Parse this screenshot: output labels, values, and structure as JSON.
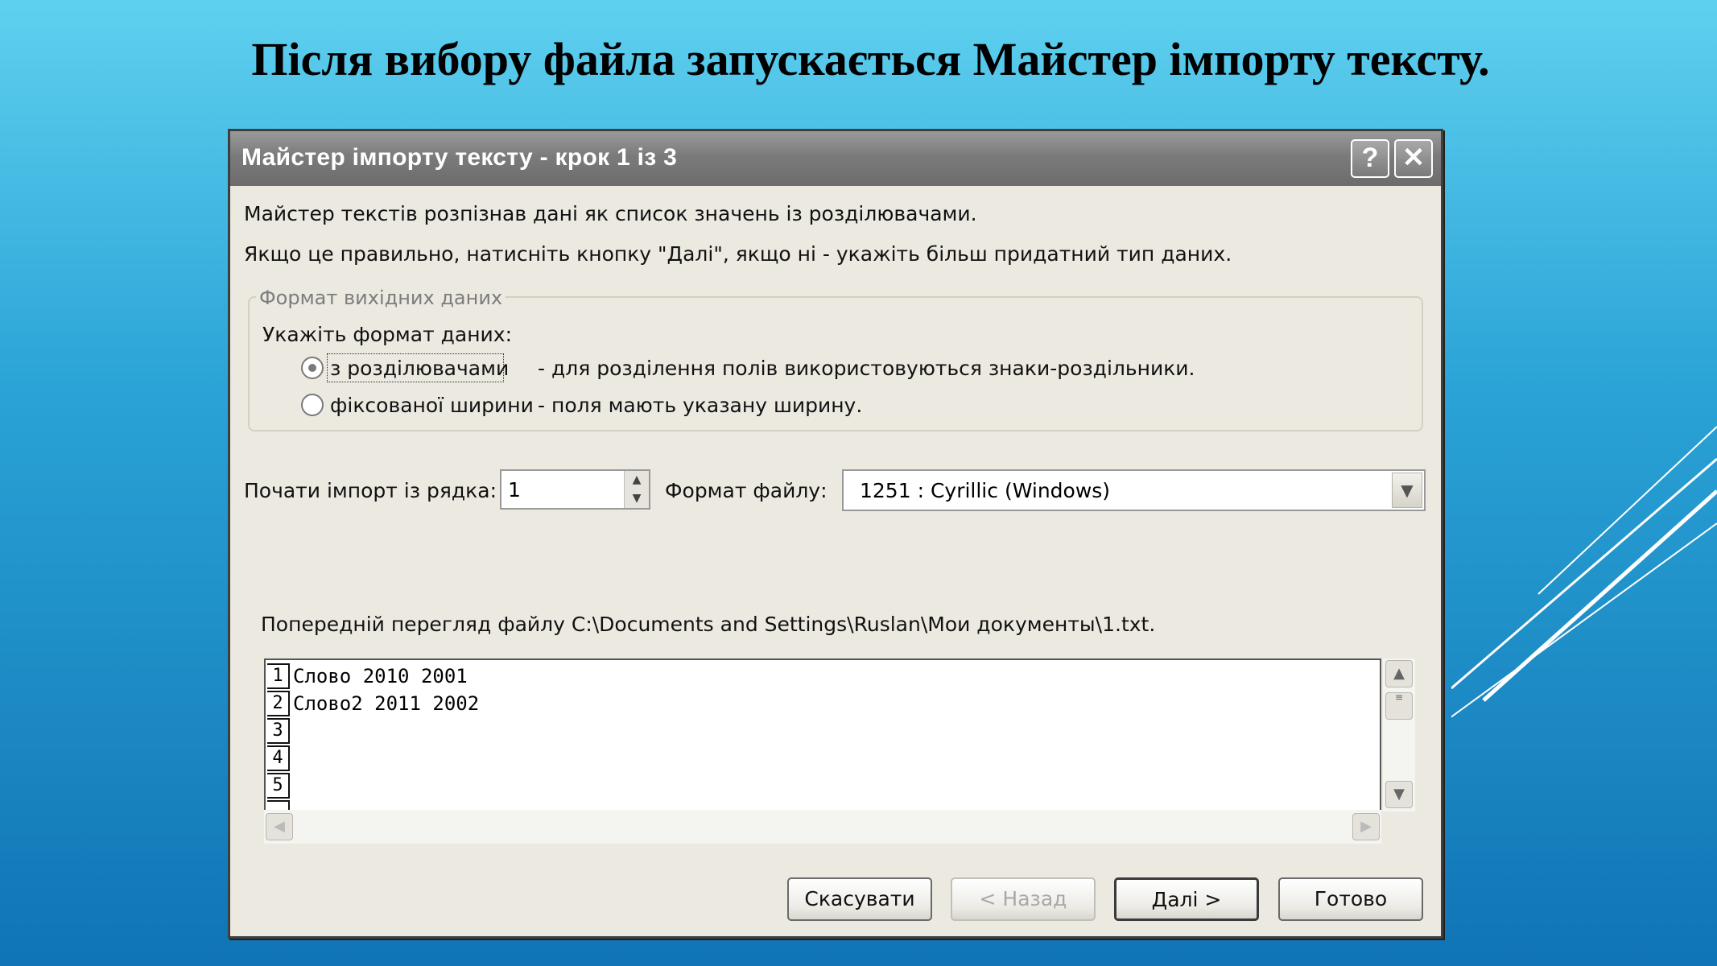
{
  "slide": {
    "title": "Після вибору файла запускається Майстер імпорту тексту."
  },
  "dialog": {
    "title": "Майстер імпорту тексту - крок 1 із 3",
    "help_label": "?",
    "close_label": "✕",
    "intro_line1": "Майстер текстів розпізнав дані як список значень із розділювачами.",
    "intro_line2": "Якщо це правильно, натисніть кнопку \"Далі\", якщо ні - укажіть більш придатний тип даних.",
    "group": {
      "legend": "Формат вихідних даних",
      "prompt": "Укажіть формат даних:",
      "options": [
        {
          "label": "з розділювачами",
          "description": "- для розділення полів використовуються знаки-роздільники.",
          "selected": true
        },
        {
          "label": "фіксованої ширини",
          "description": "- поля мають указану ширину.",
          "selected": false
        }
      ]
    },
    "start_row": {
      "label": "Почати імпорт із рядка:",
      "value": "1"
    },
    "file_format": {
      "label": "Формат файлу:",
      "value": "1251 : Cyrillic (Windows)"
    },
    "preview": {
      "label": "Попередній перегляд файлу C:\\Documents and Settings\\Ruslan\\Мои документы\\1.txt.",
      "rows": [
        {
          "num": "1",
          "text": "Слово 2010 2001"
        },
        {
          "num": "2",
          "text": "Слово2 2011 2002"
        },
        {
          "num": "3",
          "text": ""
        },
        {
          "num": "4",
          "text": ""
        },
        {
          "num": "5",
          "text": ""
        }
      ]
    },
    "buttons": {
      "cancel": "Скасувати",
      "back": "< Назад",
      "next": "Далі >",
      "finish": "Готово"
    }
  }
}
